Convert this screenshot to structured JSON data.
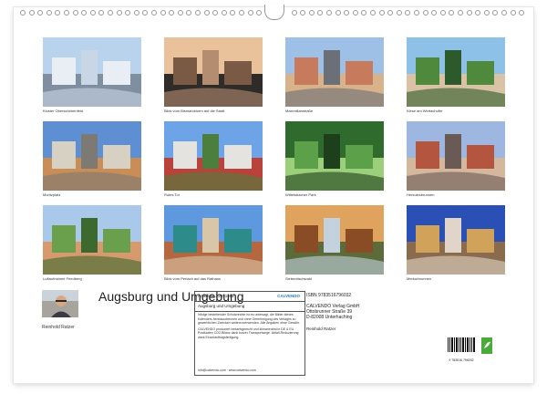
{
  "calendar": {
    "title": "Augsburg und Umgebung",
    "author": "Reinhold Ratzer",
    "thumbnails": [
      {
        "caption": "Kloster Oberschönenfeld"
      },
      {
        "caption": "Blick vom Bismarckturm auf die Stadt"
      },
      {
        "caption": "Maximilianstraße"
      },
      {
        "caption": "Kiese am Wertachufer"
      },
      {
        "caption": "Moritzplatz"
      },
      {
        "caption": "Rotes Tor"
      },
      {
        "caption": "Wittelsbacher Park"
      },
      {
        "caption": "Herkulesbrunnen"
      },
      {
        "caption": "Luftaufnahme Friedberg"
      },
      {
        "caption": "Blick vom Perlach auf das Rathaus"
      },
      {
        "caption": "Siebentischwald"
      },
      {
        "caption": "Merkurbrunnen"
      }
    ]
  },
  "info_box": {
    "article": "Artikel-Nr.: 2291052",
    "brand": "CALVENDO",
    "title_line": "Augsburg und Umgebung",
    "legal_1": "Infolge bestehender Schutzrechte ist es untersagt, die Bilder dieses Kalenders herauszutrennen und ohne Genehmigung des Verlages zu gewerblichen Zwecken weiterzuverwenden. Alle Angaben ohne Gewähr.",
    "legal_2": "CALVENDO produziert bedarfsgerecht und klimaneutral in DE & EU. Postkarten CO2-Bilanz dank kurzer Transportwege. Abfall-Reduzierung dank Einzelauftragsfertigung.",
    "contact": "info@calvendo.com · www.calvendo.com"
  },
  "publisher": {
    "isbn": "ISBN 9783516796032",
    "name": "CALVENDO Verlag GmbH",
    "street": "Ottobrunner Straße 39",
    "city": "D-82008 Unterhaching",
    "author": "Reinhold Ratzer",
    "barcode_number": "9 783516 796032"
  }
}
